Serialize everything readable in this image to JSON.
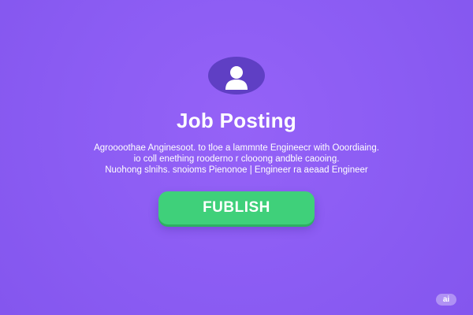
{
  "header": {
    "title": "Job Posting",
    "avatar_icon": "user-avatar-icon"
  },
  "description": {
    "lines": [
      "Agroooothae Anginesoot. to tloe a lammnte Engineecr with Ooordiaing.",
      "io coll enething rooderno r clooong andble caooing.",
      "Nuohong slnihs. snoioms Pienonoe | Engineer ra aeaad Engineer"
    ]
  },
  "actions": {
    "publish_label": "FUBLISH"
  },
  "badge": {
    "label": "ai"
  },
  "colors": {
    "background": "#8b5cf3",
    "avatar_bg": "#5f3fc4",
    "button": "#3fd07a",
    "text": "#ffffff"
  }
}
